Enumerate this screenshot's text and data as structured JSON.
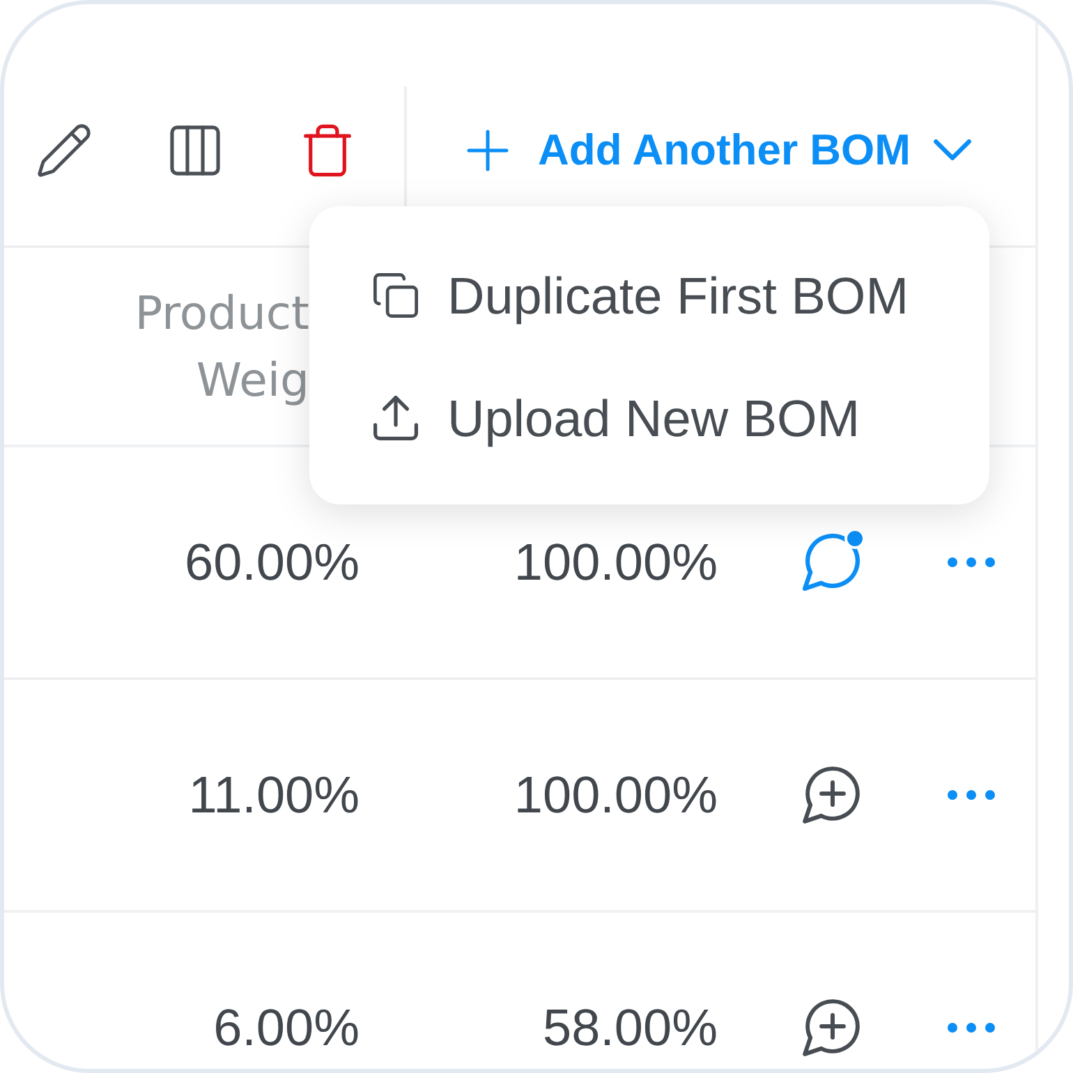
{
  "toolbar": {
    "add_button": {
      "label": "Add Another BOM",
      "expanded": true
    }
  },
  "add_menu": [
    {
      "label": "Duplicate First BOM",
      "kind": "duplicate"
    },
    {
      "label": "Upload New BOM",
      "kind": "upload"
    }
  ],
  "table": {
    "columns": [
      {
        "label": "Product Weig"
      }
    ],
    "rows": [
      {
        "cells": [
          "60.00%",
          "100.00%"
        ],
        "unread_comments": true
      },
      {
        "cells": [
          "11.00%",
          "100.00%"
        ],
        "unread_comments": false
      },
      {
        "cells": [
          "6.00%",
          "58.00%"
        ],
        "unread_comments": false
      }
    ]
  }
}
